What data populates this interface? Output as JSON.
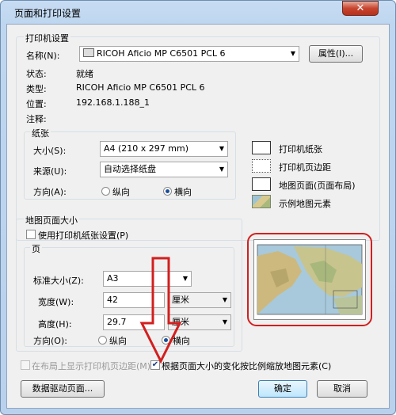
{
  "window": {
    "title": "页面和打印设置",
    "close_glyph": "✕"
  },
  "printer": {
    "group_label": "打印机设置",
    "name_label": "名称(N):",
    "name_value": "RICOH Aficio MP C6501 PCL 6",
    "properties_button": "属性(I)...",
    "status_label": "状态:",
    "status_value": "就绪",
    "type_label": "类型:",
    "type_value": "RICOH Aficio MP C6501 PCL 6",
    "location_label": "位置:",
    "location_value": "192.168.1.188_1",
    "comment_label": "注释:",
    "paper": {
      "group_label": "纸张",
      "size_label": "大小(S):",
      "size_value": "A4 (210 x 297 mm)",
      "source_label": "来源(U):",
      "source_value": "自动选择纸盘",
      "orientation_label": "方向(A):",
      "portrait_label": "纵向",
      "landscape_label": "横向",
      "selected": "landscape"
    }
  },
  "legend": {
    "items": [
      "打印机纸张",
      "打印机页边距",
      "地图页面(页面布局)",
      "示例地图元素"
    ]
  },
  "map_page": {
    "group_label": "地图页面大小",
    "use_printer_label": "使用打印机纸张设置(P)",
    "page_group_label": "页",
    "standard_size_label": "标准大小(Z):",
    "standard_size_value": "A3",
    "width_label": "宽度(W):",
    "width_value": "42",
    "width_unit": "厘米",
    "height_label": "高度(H):",
    "height_value": "29.7",
    "height_unit": "厘米",
    "orientation_label": "方向(O):",
    "portrait_label": "纵向",
    "landscape_label": "横向",
    "selected": "landscape"
  },
  "footer": {
    "show_margins_label": "在布局上显示打印机页边距(M)",
    "scale_elements_label": "根据页面大小的变化按比例缩放地图元素(C)",
    "data_driven_button": "数据驱动页面...",
    "ok_button": "确定",
    "cancel_button": "取消"
  },
  "annotation": {
    "arrow_color": "#d21f1f",
    "highlight_color": "#d21f1f"
  }
}
